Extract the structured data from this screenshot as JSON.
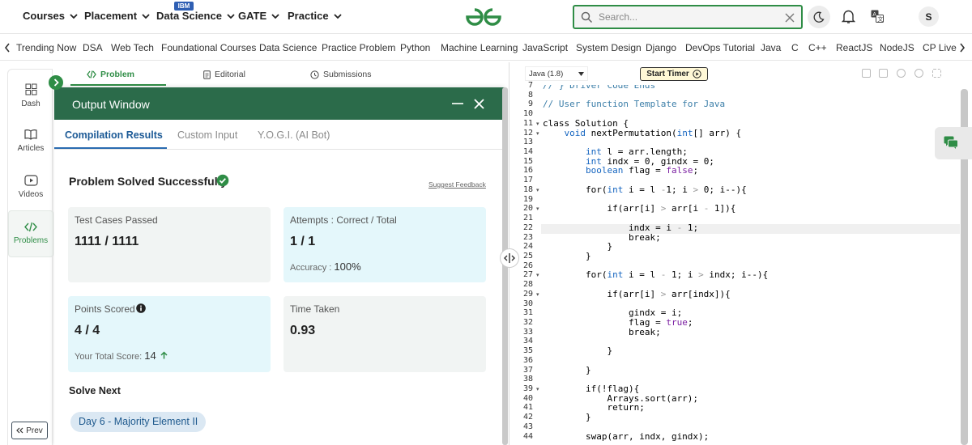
{
  "nav": {
    "items": [
      "Courses",
      "Practice",
      "Data Science",
      "GATE",
      "Practice"
    ],
    "courses": "Courses",
    "placement": "Placement",
    "data_science": "Data Science",
    "ibm_badge": "IBM",
    "gate": "GATE",
    "practice": "Practice",
    "search_placeholder": "Search...",
    "avatar_initial": "S"
  },
  "topics": [
    "Trending Now",
    "DSA",
    "Web Tech",
    "Foundational Courses",
    "Data Science",
    "Practice Problem",
    "Python",
    "Machine Learning",
    "JavaScript",
    "System Design",
    "Django",
    "DevOps Tutorial",
    "Java",
    "C",
    "C++",
    "ReactJS",
    "NodeJS",
    "CP Live"
  ],
  "sidebar": {
    "dash": "Dash",
    "articles": "Articles",
    "videos": "Videos",
    "problems": "Problems",
    "prev": "Prev"
  },
  "problem_tabs": {
    "problem": "Problem",
    "editorial": "Editorial",
    "submissions": "Submissions"
  },
  "output": {
    "title": "Output Window",
    "tabs": {
      "compilation": "Compilation Results",
      "custom": "Custom Input",
      "yogi": "Y.O.G.I. (AI Bot)"
    },
    "status": "Problem Solved Successfully",
    "feedback": "Suggest Feedback",
    "cards": {
      "tests_label": "Test Cases Passed",
      "tests_value": "1111 / 1111",
      "attempts_label": "Attempts : Correct / Total",
      "attempts_value": "1 / 1",
      "accuracy_label": "Accuracy :",
      "accuracy_value": "100%",
      "points_label": "Points Scored",
      "points_value": "4 / 4",
      "total_label": "Your Total Score:",
      "total_value": "14",
      "time_label": "Time Taken",
      "time_value": "0.93"
    },
    "solve_next": "Solve Next",
    "next_problem": "Day 6 - Majority Element II"
  },
  "editor": {
    "language": "Java (1.8)",
    "timer": "Start Timer",
    "line_numbers": [
      "7",
      "8",
      "9",
      "10",
      "11",
      "12",
      "13",
      "14",
      "15",
      "16",
      "17",
      "18",
      "19",
      "20",
      "21",
      "22",
      "23",
      "24",
      "25",
      "26",
      "27",
      "28",
      "29",
      "30",
      "31",
      "32",
      "33",
      "34",
      "35",
      "36",
      "37",
      "38",
      "39",
      "40",
      "41",
      "42",
      "43",
      "44"
    ],
    "fold_lines": [
      "11",
      "12",
      "18",
      "20",
      "27",
      "29",
      "39"
    ],
    "code": [
      "// } Driver Code Ends",
      "",
      "// User function Template for Java",
      "",
      "class Solution {",
      "    void nextPermutation(int[] arr) {",
      "",
      "        int l = arr.length;",
      "        int indx = 0, gindx = 0;",
      "        boolean flag = false;",
      "",
      "        for(int i = l -1; i > 0; i--){",
      "",
      "            if(arr[i] > arr[i - 1]){",
      "",
      "                indx = i - 1;",
      "                break;",
      "            }",
      "        }",
      "",
      "        for(int i = l - 1; i > indx; i--){",
      "",
      "            if(arr[i] > arr[indx]){",
      "",
      "                gindx = i;",
      "                flag = true;",
      "                break;",
      "",
      "            }",
      "",
      "        }",
      "",
      "        if(!flag){",
      "            Arrays.sort(arr);",
      "            return;",
      "        }",
      "",
      "        swap(arr, indx, gindx);"
    ]
  },
  "colors": {
    "brand_green": "#2f8d46",
    "output_header": "#2b6b4a",
    "active_tab_blue": "#1c5a96"
  }
}
